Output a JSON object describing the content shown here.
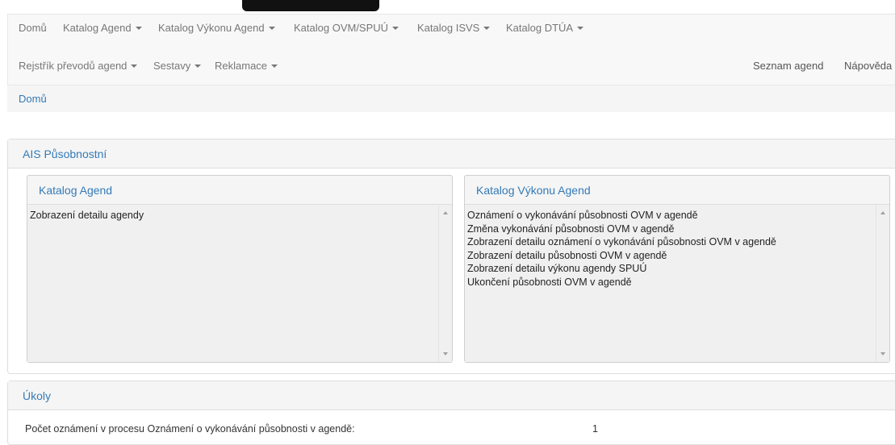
{
  "nav": {
    "row1": [
      {
        "label": "Domů",
        "dropdown": false
      },
      {
        "label": "Katalog Agend",
        "dropdown": true
      },
      {
        "label": "Katalog Výkonu Agend",
        "dropdown": true
      },
      {
        "label": "Katalog OVM/SPUÚ",
        "dropdown": true
      },
      {
        "label": "Katalog ISVS",
        "dropdown": true
      },
      {
        "label": "Katalog DTÚA",
        "dropdown": true
      }
    ],
    "row2": [
      {
        "label": "Rejstřík převodů agend",
        "dropdown": true
      },
      {
        "label": "Sestavy",
        "dropdown": true
      },
      {
        "label": "Reklamace",
        "dropdown": true
      }
    ],
    "right": {
      "seznam": "Seznam agend",
      "napoveda": "Nápověda"
    }
  },
  "breadcrumb": {
    "home": "Domů"
  },
  "ais_panel": {
    "title": "AIS Působnostní",
    "katalog_agend": {
      "title": "Katalog Agend",
      "items": [
        "Zobrazení detailu agendy"
      ]
    },
    "katalog_vykonu": {
      "title": "Katalog Výkonu Agend",
      "items": [
        "Oznámení o vykonávání působnosti OVM v agendě",
        "Změna vykonávání působnosti OVM v agendě",
        "Zobrazení detailu oznámení o vykonávání působnosti OVM v agendě",
        "Zobrazení detailu působnosti OVM v agendě",
        "Zobrazení detailu výkonu agendy SPUÚ",
        "Ukončení působnosti OVM v agendě"
      ]
    }
  },
  "ukoly": {
    "title": "Úkoly",
    "row_label": "Počet oznámení v procesu Oznámení o vykonávání působnosti v agendě:",
    "row_value": "1"
  },
  "colors": {
    "link": "#337ab7",
    "navbar_bg": "#f8f8f8",
    "panel_bg": "#f5f5f5"
  }
}
